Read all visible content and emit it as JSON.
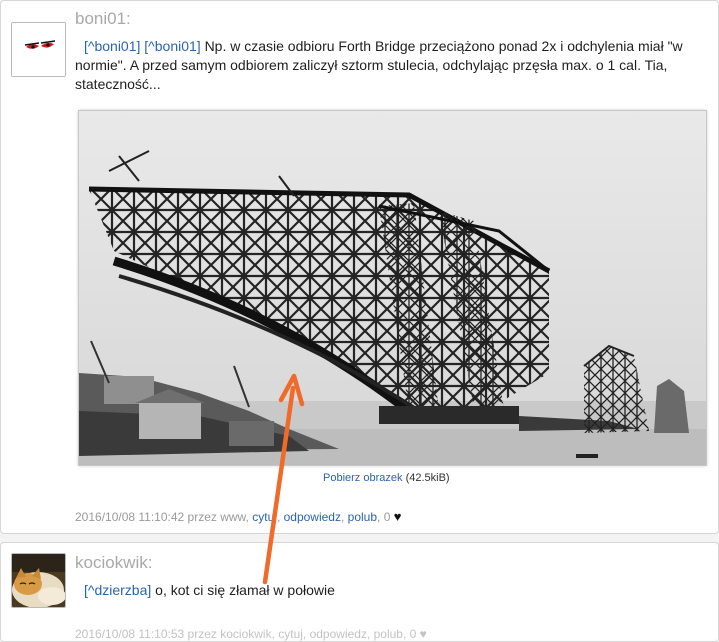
{
  "comments": [
    {
      "author": "boni01:",
      "refs": [
        "[^boni01]",
        "[^boni01]"
      ],
      "text": "Np. w czasie odbioru Forth Bridge przeciążono ponad 2x i odchylenia miał \"w normie\". A przed samym odbiorem zaliczył sztorm stulecia, odchylając przęsła max. o 1 cal. Tia, stateczność...",
      "download_link": "Pobierz obrazek",
      "download_size": "(42.5kiB)",
      "meta_prefix": "2016/10/08 11:10:42 przez www,",
      "actions": [
        "cytuj",
        "odpowiedz",
        "polub"
      ],
      "likes": "0",
      "heart_icon": "♥"
    },
    {
      "author": "kociokwik:",
      "ref": "[^dzierzba]",
      "text": "o, kot ci się złamał w połowie",
      "meta_partial": "2016/10/08 11:10:53 przez kociokwik, cytuj, odpowiedz, polub, 0 ♥"
    }
  ],
  "colors": {
    "link": "#2a64b0",
    "author": "#a9a9a9",
    "arrow": "#f06a2a"
  }
}
